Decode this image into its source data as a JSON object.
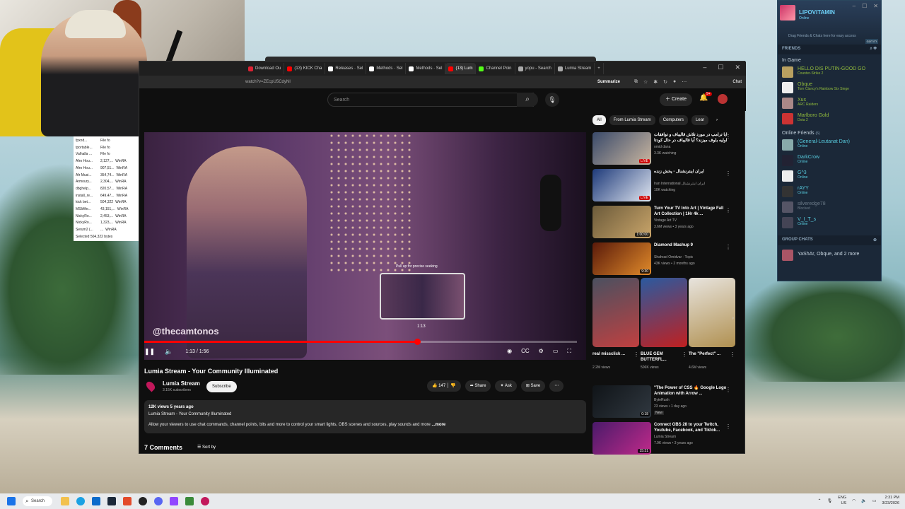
{
  "webcam": {
    "label": ""
  },
  "filelist": {
    "rows": [
      [
        "fpxnd...",
        "File fo"
      ],
      [
        "tportable...",
        "File fo"
      ],
      [
        "Valhalla ...",
        "File fo"
      ],
      [
        "Afro Hou...",
        "2,127,...",
        "WinRA"
      ],
      [
        "Afro Hou...",
        "907,51...",
        "WinRA"
      ],
      [
        "Afr Musi...",
        "354,74...",
        "WinRA"
      ],
      [
        "Armoury...",
        "2,304,...",
        "WinRA"
      ],
      [
        "dbghelp...",
        "820,57...",
        "WinRA"
      ],
      [
        "install_re...",
        "649,47...",
        "WinRA"
      ],
      [
        "kick bet...",
        "504,322",
        "WinRA"
      ],
      [
        "MSIAfte...",
        "43,151,...",
        "WinRA"
      ],
      [
        "NickyRo...",
        "2,453,...",
        "WinRA"
      ],
      [
        "NickyRo...",
        "1,323,...",
        "WinRA"
      ],
      [
        "Serum2 (...",
        "...",
        "WinRA"
      ]
    ],
    "status": "Selected 504,322 bytes"
  },
  "browser": {
    "tabs": [
      {
        "label": "Download Ou",
        "color": "#d23"
      },
      {
        "label": "(13) KICK Cha",
        "color": "#f00"
      },
      {
        "label": "Releases · Sel",
        "color": "#fff"
      },
      {
        "label": "Methods · Sel",
        "color": "#fff"
      },
      {
        "label": "Methods · Sel",
        "color": "#fff"
      },
      {
        "label": "(13) Lum",
        "color": "#f00",
        "active": true
      },
      {
        "label": "Channel Poin",
        "color": "#53fc18"
      },
      {
        "label": "yopu - Search",
        "color": "#aaa"
      },
      {
        "label": "Lumia Stream",
        "color": "#aaa"
      }
    ],
    "url": "watch?v=ZEcpU5CdyNI",
    "summarize": "Summarize",
    "chat": "Chat"
  },
  "yt": {
    "search_placeholder": "Search",
    "create": "Create",
    "notif_count": "9+",
    "player": {
      "watermark": "@thecamtonos",
      "preview_hint": "Pull up for precise seeking",
      "preview_time": "1:13",
      "time": "1:13 / 1:56",
      "progress": 0.63
    },
    "title": "Lumia Stream - Your Community Illuminated",
    "channel": "Lumia Stream",
    "subs": "3.15K subscribers",
    "subscribe": "Subscribe",
    "likes": "147",
    "share": "Share",
    "ask": "Ask",
    "save": "Save",
    "desc_meta": "12K views  5 years ago",
    "desc_line": "Lumia Stream - Your Community Illuminated",
    "desc_body": "Allow your viewers to use chat commands, channel points, bits and more to control your smart lights, OBS scenes and sources, play sounds and more",
    "desc_more": "...more",
    "comments": "7 Comments",
    "sort": "Sort by",
    "chips": [
      "All",
      "From Lumia Stream",
      "Computers",
      "Lear"
    ],
    "videos": [
      {
        "title": "آیا ترامپ در مورد تلاش قالیباف و توافقات اولیه بلوف میزند؟ آیا قالیباف در حال کودتا",
        "channel": "omid dana",
        "meta": "3.3K watching",
        "live": "LIVE",
        "c1": "#3a4a6a",
        "c2": "#c9b6a0"
      },
      {
        "title": "ایران اینترنشنال - پخش زنده",
        "channel": "Iran International ایران اینترنشنال",
        "meta": "10K watching",
        "live": "LIVE",
        "c1": "#1e3a7a",
        "c2": "#e0e6f0"
      },
      {
        "title": "Turn Your TV Into Art | Vintage Fall Art Collection | 1Hr 4k ...",
        "channel": "Vintage Art TV",
        "meta": "3.6M views • 3 years ago",
        "dur": "1:00:00",
        "c1": "#6b5a3a",
        "c2": "#c9a56a"
      },
      {
        "title": "Diamond Mashup 9",
        "channel": "Shahrad Omidvar · Topic",
        "meta": "43K views • 2 months ago",
        "dur": "9:30",
        "c1": "#5a1a0a",
        "c2": "#e08a2a"
      }
    ],
    "shorts": [
      {
        "title": "real missclick ...",
        "views": "2.2M views",
        "c1": "#4a5060",
        "c2": "#c04040"
      },
      {
        "title": "BLUE GEM BUTTERFL...",
        "views": "506K views",
        "c1": "#2a5aa0",
        "c2": "#c02020"
      },
      {
        "title": "The \"Perfect\" ...",
        "views": "4.6M views",
        "c1": "#e8e4de",
        "c2": "#b09050"
      }
    ],
    "videos2": [
      {
        "title": "\"The Power of CSS 🔥 Google Logo Animation with Arrow ...",
        "channel": "ByteRush",
        "meta": "23 views • 1 day ago",
        "new": "New",
        "dur": "0:18",
        "c1": "#101418",
        "c2": "#303840"
      },
      {
        "title": "Connect OBS 28 to your Twitch, Youtube, Facebook, and Tiktok...",
        "channel": "Lumia Stream",
        "meta": "7.9K views • 3 years ago",
        "dur": "15:31",
        "c1": "#4a1a6a",
        "c2": "#c02a8a"
      }
    ]
  },
  "steam": {
    "user": "LIPOVITAMIN",
    "status": "Online",
    "drag_hint": "Drag Friends & Chats here for easy access",
    "got_it": "GOT IT!",
    "friends_header": "FRIENDS",
    "in_game": "In Game",
    "in_game_list": [
      {
        "name": "HELLO DIS PUTIN-GOOD GO",
        "game": "Counter-Strike 2",
        "c": "#b8a060"
      },
      {
        "name": "Obque",
        "game": "Tom Clancy's Rainbow Six Siege",
        "c": "#eee"
      },
      {
        "name": "Xus",
        "game": "ARC Raiders",
        "c": "#a88"
      },
      {
        "name": "Marlboro Gold",
        "game": "Dota 2",
        "c": "#c33"
      }
    ],
    "online_label": "Online Friends",
    "online_count": "(6)",
    "online_list": [
      {
        "name": "(General-Leutanat Dan)",
        "status": "Online",
        "c": "#8aa"
      },
      {
        "name": "DarkCrow",
        "status": "Online",
        "c": "#223"
      },
      {
        "name": "G^3",
        "status": "Online",
        "c": "#eee"
      },
      {
        "name": "rAYY",
        "status": "Online",
        "c": "#333"
      },
      {
        "name": "silveredge78",
        "status": "Blocked",
        "c": "#556"
      },
      {
        "name": "V_I_T_s",
        "status": "Online",
        "c": "#445"
      }
    ],
    "group_header": "GROUP CHATS",
    "group": "YaShAr, Obque, and 2 more"
  },
  "taskbar": {
    "search": "Search",
    "lang": "ENG",
    "region": "US",
    "time": "2:31 PM",
    "date": "3/23/2026"
  }
}
